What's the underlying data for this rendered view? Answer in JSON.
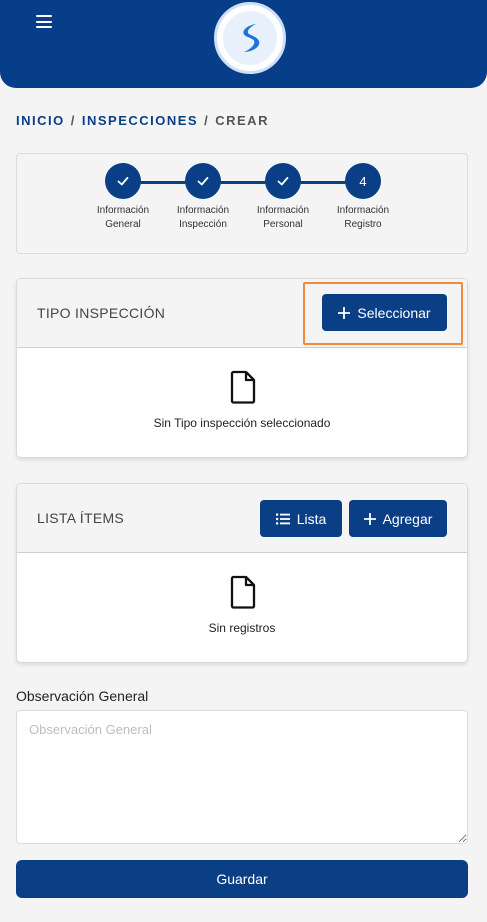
{
  "header": {
    "menu_icon": "hamburger-icon",
    "logo_icon": "brand-logo",
    "brand_color": "#073e8a"
  },
  "breadcrumb": {
    "items": [
      "INICIO",
      "INSPECCIONES"
    ],
    "current": "CREAR",
    "separator": "/"
  },
  "stepper": {
    "steps": [
      {
        "line1": "Información",
        "line2": "General",
        "state": "completed",
        "icon": "check-icon"
      },
      {
        "line1": "Información",
        "line2": "Inspección",
        "state": "completed",
        "icon": "check-icon"
      },
      {
        "line1": "Información",
        "line2": "Personal",
        "state": "completed",
        "icon": "check-icon"
      },
      {
        "line1": "Información",
        "line2": "Registro",
        "state": "current",
        "number": "4"
      }
    ]
  },
  "tipo_inspeccion": {
    "title": "TIPO INSPECCIÓN",
    "select_button": "Seleccionar",
    "select_icon": "plus-icon",
    "empty_icon": "file-icon",
    "empty_message": "Sin Tipo inspección seleccionado"
  },
  "lista_items": {
    "title": "LISTA ÍTEMS",
    "list_button": "Lista",
    "list_icon": "list-icon",
    "add_button": "Agregar",
    "add_icon": "plus-icon",
    "empty_icon": "file-icon",
    "empty_message": "Sin registros"
  },
  "observacion": {
    "label": "Observación General",
    "placeholder": "Observación General",
    "value": ""
  },
  "save_button": "Guardar",
  "colors": {
    "primary": "#0a3f85",
    "highlight": "#f08a3e",
    "background": "#f4f4f5"
  }
}
